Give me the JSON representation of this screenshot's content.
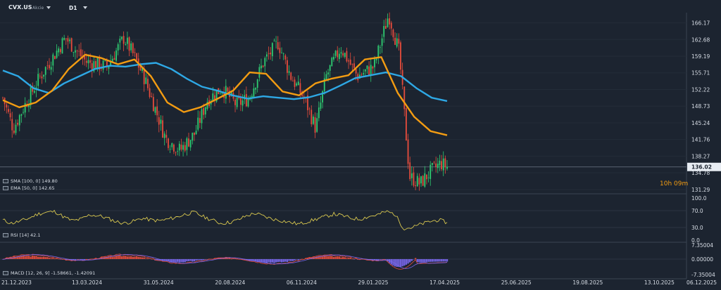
{
  "header": {
    "symbol": "CVX.US",
    "symbol_note": "Akcie",
    "timeframe": "D1"
  },
  "price_pane": {
    "current_price_label": "136.02",
    "countdown": "10h 09m",
    "legend": [
      {
        "label": "SMA [100, 0] 149.80",
        "color": "#2ea8e5"
      },
      {
        "label": "EMA [50, 0] 142.65",
        "color": "#f39c12"
      }
    ]
  },
  "rsi_pane": {
    "legend_label": "RSI [14] 42.1",
    "axis_labels": [
      "100.0",
      "70.0",
      "30.0",
      "0.0"
    ]
  },
  "macd_pane": {
    "legend_label": "MACD [12, 26, 9] -1.58661, -1.42091",
    "axis_labels": [
      "7.35004",
      "0.00000",
      "-7.35004"
    ]
  },
  "colors": {
    "background": "#1c2430",
    "candle_up": "#2ecc71",
    "candle_down": "#e74c3c",
    "sma": "#2ea8e5",
    "ema": "#f39c12",
    "rsi": "#d9c84f",
    "macd_hist_pos": "#e74c3c",
    "macd_hist_neg": "#7b68ee"
  },
  "chart_data": [
    {
      "type": "candlestick",
      "title": "CVX.US D1",
      "y_ticks": [
        166.17,
        162.68,
        159.19,
        155.71,
        152.22,
        148.73,
        145.24,
        141.76,
        138.27,
        134.78,
        131.29
      ],
      "ylim": [
        130.4,
        168.3
      ],
      "x_ticks": [
        "21.12.2023",
        "13.03.2024",
        "31.05.2024",
        "20.08.2024",
        "06.11.2024",
        "29.01.2025",
        "17.04.2025",
        "25.06.2025",
        "19.08.2025",
        "13.10.2025",
        "06.12.2025"
      ],
      "current_price": 136.02,
      "close_path": {
        "x": [
          "21.12.2023",
          "13.03.2024",
          "31.05.2024",
          "20.08.2024",
          "06.11.2024",
          "29.01.2025",
          "17.04.2025"
        ],
        "approx_points": [
          [
            0,
            150.5
          ],
          [
            0.05,
            144.0
          ],
          [
            0.1,
            148.5
          ],
          [
            0.18,
            155.0
          ],
          [
            0.3,
            163.0
          ],
          [
            0.4,
            158.0
          ],
          [
            0.5,
            157.0
          ],
          [
            0.58,
            163.0
          ],
          [
            0.62,
            160.0
          ],
          [
            0.68,
            154.5
          ],
          [
            0.78,
            142.0
          ],
          [
            0.85,
            139.5
          ],
          [
            0.92,
            143.0
          ],
          [
            0.98,
            150.0
          ],
          [
            1.05,
            152.5
          ],
          [
            1.12,
            149.0
          ],
          [
            1.18,
            150.5
          ],
          [
            1.25,
            158.0
          ],
          [
            1.32,
            162.0
          ],
          [
            1.38,
            155.0
          ],
          [
            1.45,
            150.0
          ],
          [
            1.5,
            144.0
          ],
          [
            1.55,
            155.0
          ],
          [
            1.62,
            161.0
          ],
          [
            1.7,
            155.0
          ],
          [
            1.78,
            157.0
          ],
          [
            1.85,
            168.0
          ],
          [
            1.9,
            160.0
          ],
          [
            1.95,
            134.0
          ],
          [
            2.0,
            132.5
          ],
          [
            2.05,
            135.0
          ],
          [
            2.1,
            136.8
          ],
          [
            2.13,
            136.02
          ]
        ],
        "note_x": "x in units of 30-day blocks is not printed; points approximate close level by position between date ticks"
      },
      "series": [
        {
          "name": "SMA [100, 0]",
          "last_value": 149.8,
          "approx_values": [
            156.2,
            155.0,
            152.5,
            151.5,
            153.5,
            155.0,
            156.5,
            157.2,
            157.0,
            157.5,
            157.8,
            156.5,
            154.5,
            152.8,
            152.0,
            151.0,
            150.3,
            150.8,
            150.5,
            150.2,
            150.6,
            151.5,
            153.0,
            154.6,
            155.2,
            155.8,
            155.0,
            152.5,
            150.5,
            149.8
          ]
        },
        {
          "name": "EMA [50, 0]",
          "last_value": 142.65,
          "approx_values": [
            150.0,
            148.5,
            149.5,
            152.0,
            156.5,
            159.5,
            158.8,
            157.5,
            158.5,
            155.0,
            149.5,
            147.5,
            148.5,
            150.2,
            152.0,
            155.8,
            155.5,
            151.8,
            151.0,
            153.5,
            154.5,
            155.2,
            158.5,
            159.0,
            151.5,
            146.5,
            143.5,
            142.65
          ]
        }
      ]
    },
    {
      "type": "line",
      "title": "RSI [14]",
      "ylim": [
        0,
        100
      ],
      "y_ticks": [
        100.0,
        70.0,
        30.0,
        0.0
      ],
      "series": [
        {
          "name": "RSI [14]",
          "last_value": 42.1,
          "approx_values": [
            48,
            40,
            45,
            52,
            62,
            66,
            68,
            55,
            46,
            50,
            60,
            58,
            52,
            44,
            40,
            45,
            52,
            48,
            46,
            50,
            55,
            62,
            66,
            56,
            48,
            40,
            42,
            48,
            58,
            64,
            56,
            50,
            46,
            42,
            38,
            44,
            50,
            56,
            62,
            58,
            52,
            50,
            56,
            60,
            68,
            62,
            28,
            30,
            38,
            44,
            48,
            42.1
          ]
        }
      ]
    },
    {
      "type": "line",
      "title": "MACD [12, 26, 9]",
      "ylim": [
        -7.35004,
        7.35004
      ],
      "y_ticks": [
        7.35004,
        0.0,
        -7.35004
      ],
      "series": [
        {
          "name": "MACD",
          "last_value": -1.58661
        },
        {
          "name": "Signal",
          "last_value": -1.42091
        }
      ]
    }
  ]
}
